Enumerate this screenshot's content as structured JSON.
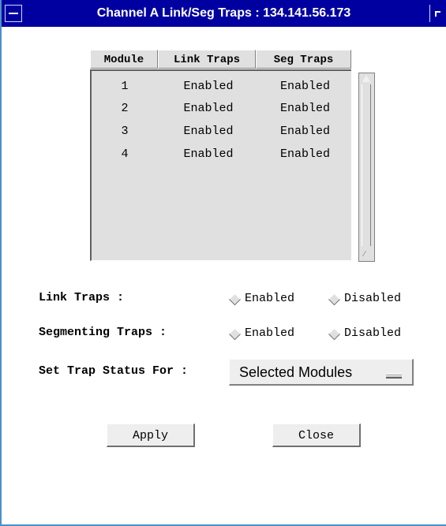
{
  "window": {
    "title": "Channel A Link/Seg Traps : 134.141.56.173"
  },
  "table": {
    "headers": [
      "Module",
      "Link Traps",
      "Seg Traps"
    ],
    "rows": [
      {
        "module": "1",
        "link": "Enabled",
        "seg": "Enabled"
      },
      {
        "module": "2",
        "link": "Enabled",
        "seg": "Enabled"
      },
      {
        "module": "3",
        "link": "Enabled",
        "seg": "Enabled"
      },
      {
        "module": "4",
        "link": "Enabled",
        "seg": "Enabled"
      }
    ]
  },
  "link_traps": {
    "label": "Link Traps :",
    "enabled": "Enabled",
    "disabled": "Disabled"
  },
  "seg_traps": {
    "label": "Segmenting Traps :",
    "enabled": "Enabled",
    "disabled": "Disabled"
  },
  "set_trap": {
    "label": "Set Trap Status For :",
    "value": "Selected Modules"
  },
  "buttons": {
    "apply": "Apply",
    "close": "Close"
  }
}
